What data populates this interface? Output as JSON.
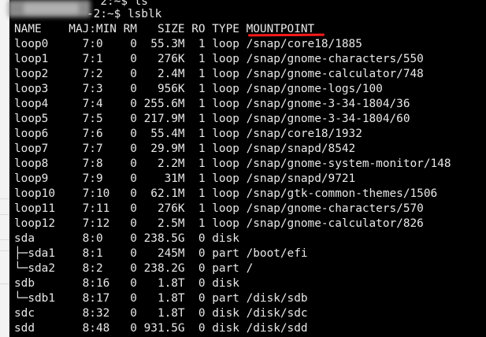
{
  "terminal": {
    "prompt_partial": "  2:~$ ls",
    "command_line": "-2:~$ lsblk",
    "header": "NAME    MAJ:MIN RM   SIZE RO TYPE MOUNTPOINT",
    "header_name": "NAME    MAJ:MIN RM   SIZE RO TYPE ",
    "header_mountpoint": "MOUNTPOINT",
    "annotation_color": "#ff1a1a",
    "rows": [
      "loop0     7:0    0  55.3M  1 loop /snap/core18/1885",
      "loop1     7:1    0   276K  1 loop /snap/gnome-characters/550",
      "loop2     7:2    0   2.4M  1 loop /snap/gnome-calculator/748",
      "loop3     7:3    0   956K  1 loop /snap/gnome-logs/100",
      "loop4     7:4    0 255.6M  1 loop /snap/gnome-3-34-1804/36",
      "loop5     7:5    0 217.9M  1 loop /snap/gnome-3-34-1804/60",
      "loop6     7:6    0  55.4M  1 loop /snap/core18/1932",
      "loop7     7:7    0  29.9M  1 loop /snap/snapd/8542",
      "loop8     7:8    0   2.2M  1 loop /snap/gnome-system-monitor/148",
      "loop9     7:9    0    31M  1 loop /snap/snapd/9721",
      "loop10    7:10   0  62.1M  1 loop /snap/gtk-common-themes/1506",
      "loop11    7:11   0   276K  1 loop /snap/gnome-characters/570",
      "loop12    7:12   0   2.5M  1 loop /snap/gnome-calculator/826",
      "sda       8:0    0 238.5G  0 disk",
      "├─sda1    8:1    0   245M  0 part /boot/efi",
      "└─sda2    8:2    0 238.2G  0 part /",
      "sdb       8:16   0   1.8T  0 disk",
      "└─sdb1    8:17   0   1.8T  0 part /disk/sdb",
      "sdc       8:32   0   1.8T  0 disk /disk/sdc",
      "sdd       8:48   0 931.5G  0 disk /disk/sdd"
    ]
  }
}
